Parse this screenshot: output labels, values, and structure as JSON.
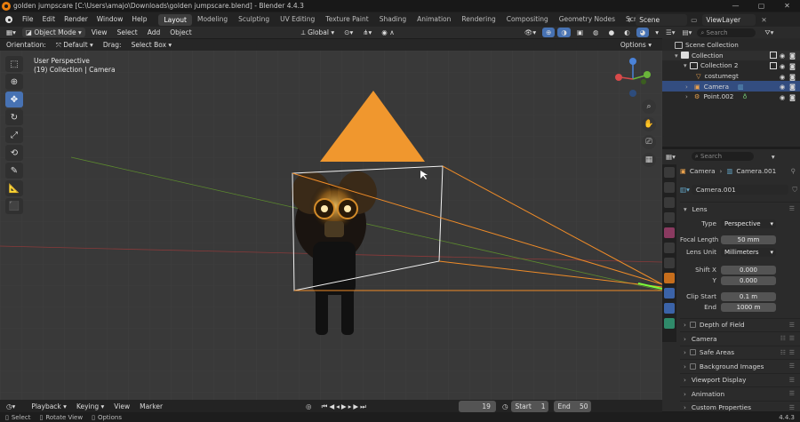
{
  "window": {
    "title": "golden jumpscare [C:\\Users\\amajo\\Downloads\\golden jumpscare.blend] - Blender 4.4.3",
    "controls": [
      "—",
      "▢",
      "✕"
    ]
  },
  "menu": [
    "File",
    "Edit",
    "Render",
    "Window",
    "Help"
  ],
  "workspaces": [
    "Layout",
    "Modeling",
    "Sculpting",
    "UV Editing",
    "Texture Paint",
    "Shading",
    "Animation",
    "Rendering",
    "Compositing",
    "Geometry Nodes",
    "Scripting"
  ],
  "active_workspace": "Layout",
  "scene": "Scene",
  "view_layer": "ViewLayer",
  "viewport_header": {
    "mode": "Object Mode",
    "menus": [
      "View",
      "Select",
      "Add",
      "Object"
    ],
    "orientation": "Global"
  },
  "viewport_tool": {
    "orientation_label": "Orientation:",
    "orientation_value": "Default",
    "drag_label": "Drag:",
    "drag_value": "Select Box",
    "options": "Options"
  },
  "viewport_info": {
    "line1": "User Perspective",
    "line2": "(19) Collection | Camera"
  },
  "outliner": {
    "search_placeholder": "Search",
    "rows": [
      {
        "label": "Scene Collection"
      },
      {
        "label": "Collection"
      },
      {
        "label": "Collection 2"
      },
      {
        "label": "costumegt"
      },
      {
        "label": "Camera"
      },
      {
        "label": "Point.002"
      }
    ]
  },
  "properties": {
    "search_placeholder": "Search",
    "breadcrumb": [
      "Camera",
      "Camera.001"
    ],
    "datablock": "Camera.001",
    "lens_section": "Lens",
    "fields": {
      "type_label": "Type",
      "type_value": "Perspective",
      "focal_label": "Focal Length",
      "focal_value": "50 mm",
      "lens_unit_label": "Lens Unit",
      "lens_unit_value": "Millimeters",
      "shiftx_label": "Shift X",
      "shiftx_value": "0.000",
      "shifty_label": "Y",
      "shifty_value": "0.000",
      "clipstart_label": "Clip Start",
      "clipstart_value": "0.1 m",
      "clipend_label": "End",
      "clipend_value": "1000 m"
    },
    "sections": [
      "Depth of Field",
      "Camera",
      "Safe Areas",
      "Background Images",
      "Viewport Display",
      "Animation",
      "Custom Properties"
    ]
  },
  "timeline": {
    "menus": [
      "Playback",
      "Keying",
      "View",
      "Marker"
    ],
    "current_frame": "19",
    "start_label": "Start",
    "start": "1",
    "end_label": "End",
    "end": "50"
  },
  "status": {
    "items": [
      "Select",
      "Rotate View",
      "Options"
    ],
    "version": "4.4.3"
  },
  "colors": {
    "accent": "#4772b3",
    "selection": "#334d80",
    "cone": "#f0972e",
    "blender_orange": "#e87d0d"
  }
}
